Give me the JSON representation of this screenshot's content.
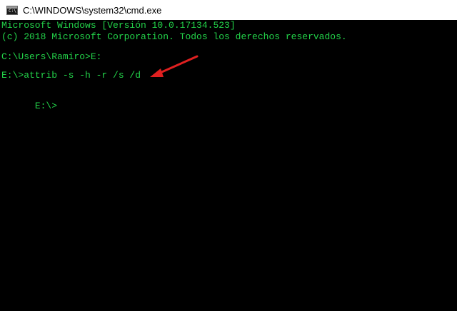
{
  "window": {
    "title": "C:\\WINDOWS\\system32\\cmd.exe",
    "icon": "cmd-icon"
  },
  "console": {
    "lines": [
      "Microsoft Windows [Versión 10.0.17134.523]",
      "(c) 2018 Microsoft Corporation. Todos los derechos reservados.",
      "",
      "C:\\Users\\Ramiro>E:",
      "",
      "E:\\>attrib -s -h -r /s /d",
      "",
      "E:\\>"
    ],
    "text_color": "#23d44a",
    "background": "#000000"
  },
  "annotation": {
    "arrow_color": "#e02020",
    "arrow_target": "attrib command line"
  }
}
